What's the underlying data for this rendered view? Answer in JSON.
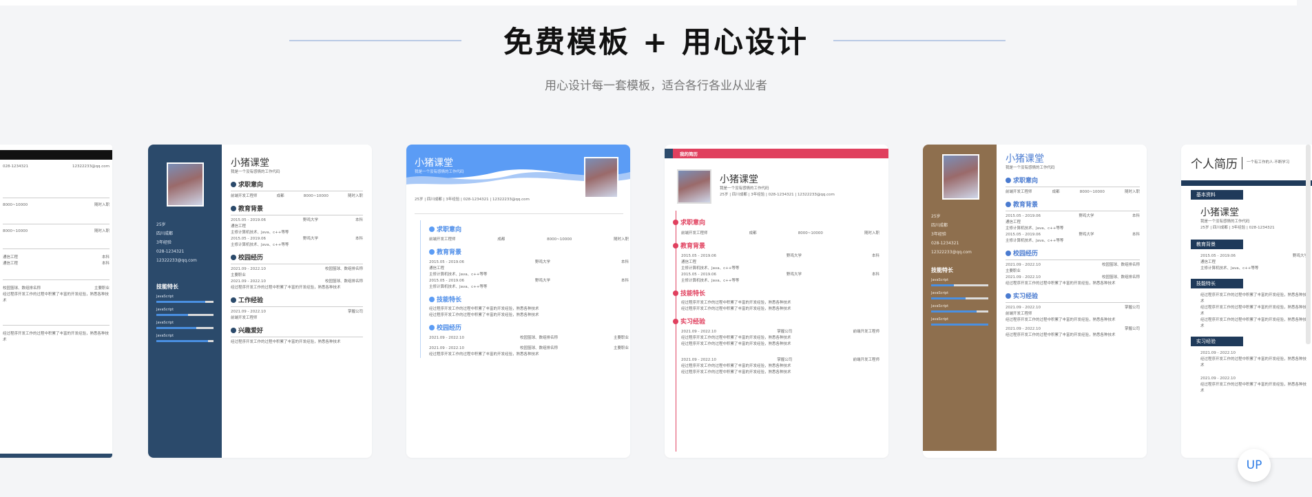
{
  "hero": {
    "title": "免费模板 + 用心设计",
    "subtitle": "用心设计每一套模板，适合各行各业从业者"
  },
  "resume": {
    "name": "小猪课堂",
    "tagline": "我是一个没有感情的工作代码",
    "age": "25岁",
    "city": "四川成都",
    "exp": "3年经验",
    "phone": "028-1234321",
    "email": "12322233@qq.com",
    "sec_intent": "求职意向",
    "sec_edu": "教育背景",
    "sec_campus": "校园经历",
    "sec_work": "工作经验",
    "sec_intern": "实习经验",
    "sec_skills": "技能特长",
    "sec_hobby": "兴趣爱好",
    "intent_job": "前端开发工程师",
    "intent_city": "成都",
    "intent_salary": "8000~10000",
    "intent_time": "随时入职",
    "edu_date": "2015.05 - 2019.06",
    "edu_school": "野鸡大学",
    "edu_degree": "本科",
    "edu_major": "通信工程",
    "edu_course": "主修计算机技术、Java、c++等等",
    "campus_date": "2021.09 - 2022.10",
    "campus_org": "校园篮球、数组排名称",
    "campus_role": "主要职业",
    "work_date": "2021.09 - 2022.10",
    "work_company": "掌握公司",
    "work_role": "前端开发工程师",
    "skill": "JavaScript",
    "interview_label": "求职意向",
    "card4_badge": "我的简历",
    "card6_title": "个人简历",
    "card6_sub": "一个有工作的人·不断学习",
    "card6_basic": "基本资料",
    "card6_edu": "教育背景",
    "card6_skill": "技能特长",
    "card6_intern": "实习经验",
    "misc_text": "经过程序开发工作的过程中积累了丰富的开发经验，熟悉各种技术"
  },
  "up_button": "UP",
  "colors": {
    "navy": "#2b4a6b",
    "blue": "#5b9cf5",
    "pink": "#e0405e",
    "brown": "#8e6f4e",
    "darkblue": "#1f3a5a"
  }
}
